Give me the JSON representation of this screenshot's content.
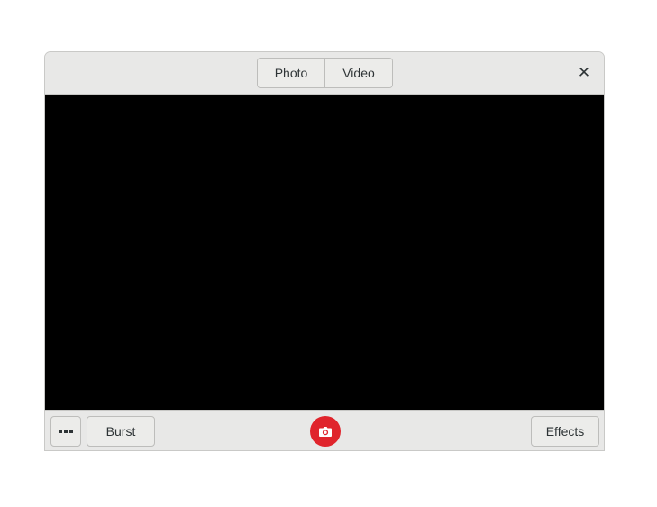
{
  "header": {
    "tabs": [
      {
        "label": "Photo"
      },
      {
        "label": "Video"
      }
    ],
    "close_icon": "close-icon"
  },
  "action_bar": {
    "more_icon": "more-options-icon",
    "burst_label": "Burst",
    "shutter_icon": "camera-icon",
    "effects_label": "Effects"
  },
  "colors": {
    "shutter": "#e0242c",
    "viewfinder": "#000000",
    "chrome": "#e8e8e7"
  }
}
